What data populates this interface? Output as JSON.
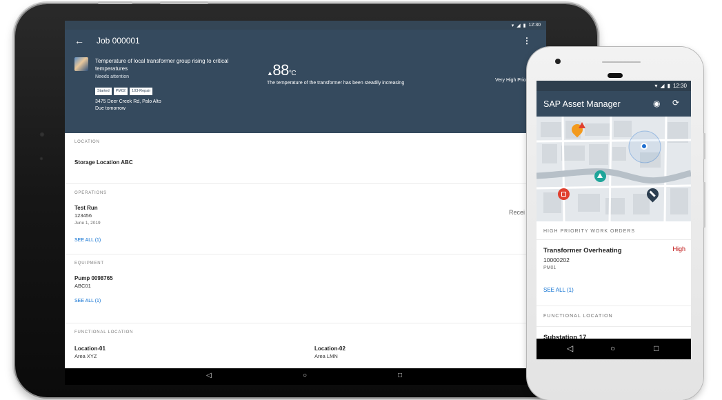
{
  "tablet": {
    "status_time": "12:30",
    "header": {
      "back_icon": "arrow-left-icon",
      "title": "Job 000001",
      "more_icon": "more-vertical-icon",
      "description": "Temperature of local transformer group rising to critical temperatures",
      "status": "Needs attention",
      "tags": [
        "Started",
        "PM02",
        "103-Repair"
      ],
      "address": "3475 Deer Creek Rd, Palo Alto",
      "due": "Due tomorrow",
      "temperature_value": "88",
      "temperature_unit": "°C",
      "temperature_caption": "The temperature of the transformer has been steadily increasing",
      "priority": "Very High Prio"
    },
    "location": {
      "label": "LOCATION",
      "value": "Storage Location ABC"
    },
    "operations": {
      "label": "OPERATIONS",
      "title": "Test Run",
      "number": "123456",
      "date": "June 1, 2019",
      "received": "Recei",
      "see_all": "SEE ALL (1)"
    },
    "equipment": {
      "label": "EQUIPMENT",
      "title": "Pump 0098765",
      "sub": "ABC01",
      "see_all": "SEE ALL (1)"
    },
    "functional_location": {
      "label": "FUNCTIONAL LOCATION",
      "items": [
        {
          "title": "Location-01",
          "sub": "Area XYZ"
        },
        {
          "title": "Location-02",
          "sub": "Area LMN"
        }
      ]
    },
    "nav": {
      "back": "◁",
      "home": "○",
      "recents": "□"
    }
  },
  "phone": {
    "status_time": "12:30",
    "app_title": "SAP Asset Manager",
    "account_icon": "account-circle-icon",
    "sync_icon": "sync-icon",
    "map": {
      "pins": [
        "fire-warning-pin-icon",
        "my-location-icon",
        "alert-pin-icon",
        "building-pin-icon",
        "wrench-pin-icon"
      ],
      "colors": {
        "orange": "#f39a1d",
        "red": "#e0402f",
        "teal": "#1fa59a",
        "navy": "#2c3e50",
        "blue": "#1f6fd0"
      }
    },
    "high_priority": {
      "label": "HIGH PRIORITY WORK ORDERS",
      "title": "Transformer Overheating",
      "number": "10000202",
      "sub": "PM01",
      "priority": "High",
      "see_all": "SEE ALL (1)"
    },
    "functional_location": {
      "label": "FUNCTIONAL LOCATION",
      "partial_item": "Substation 17"
    },
    "nav": {
      "back": "◁",
      "home": "○",
      "recents": "□"
    }
  },
  "colors": {
    "shell_header": "#354a5e",
    "link": "#0a6ed1",
    "negative": "#bb0000"
  }
}
